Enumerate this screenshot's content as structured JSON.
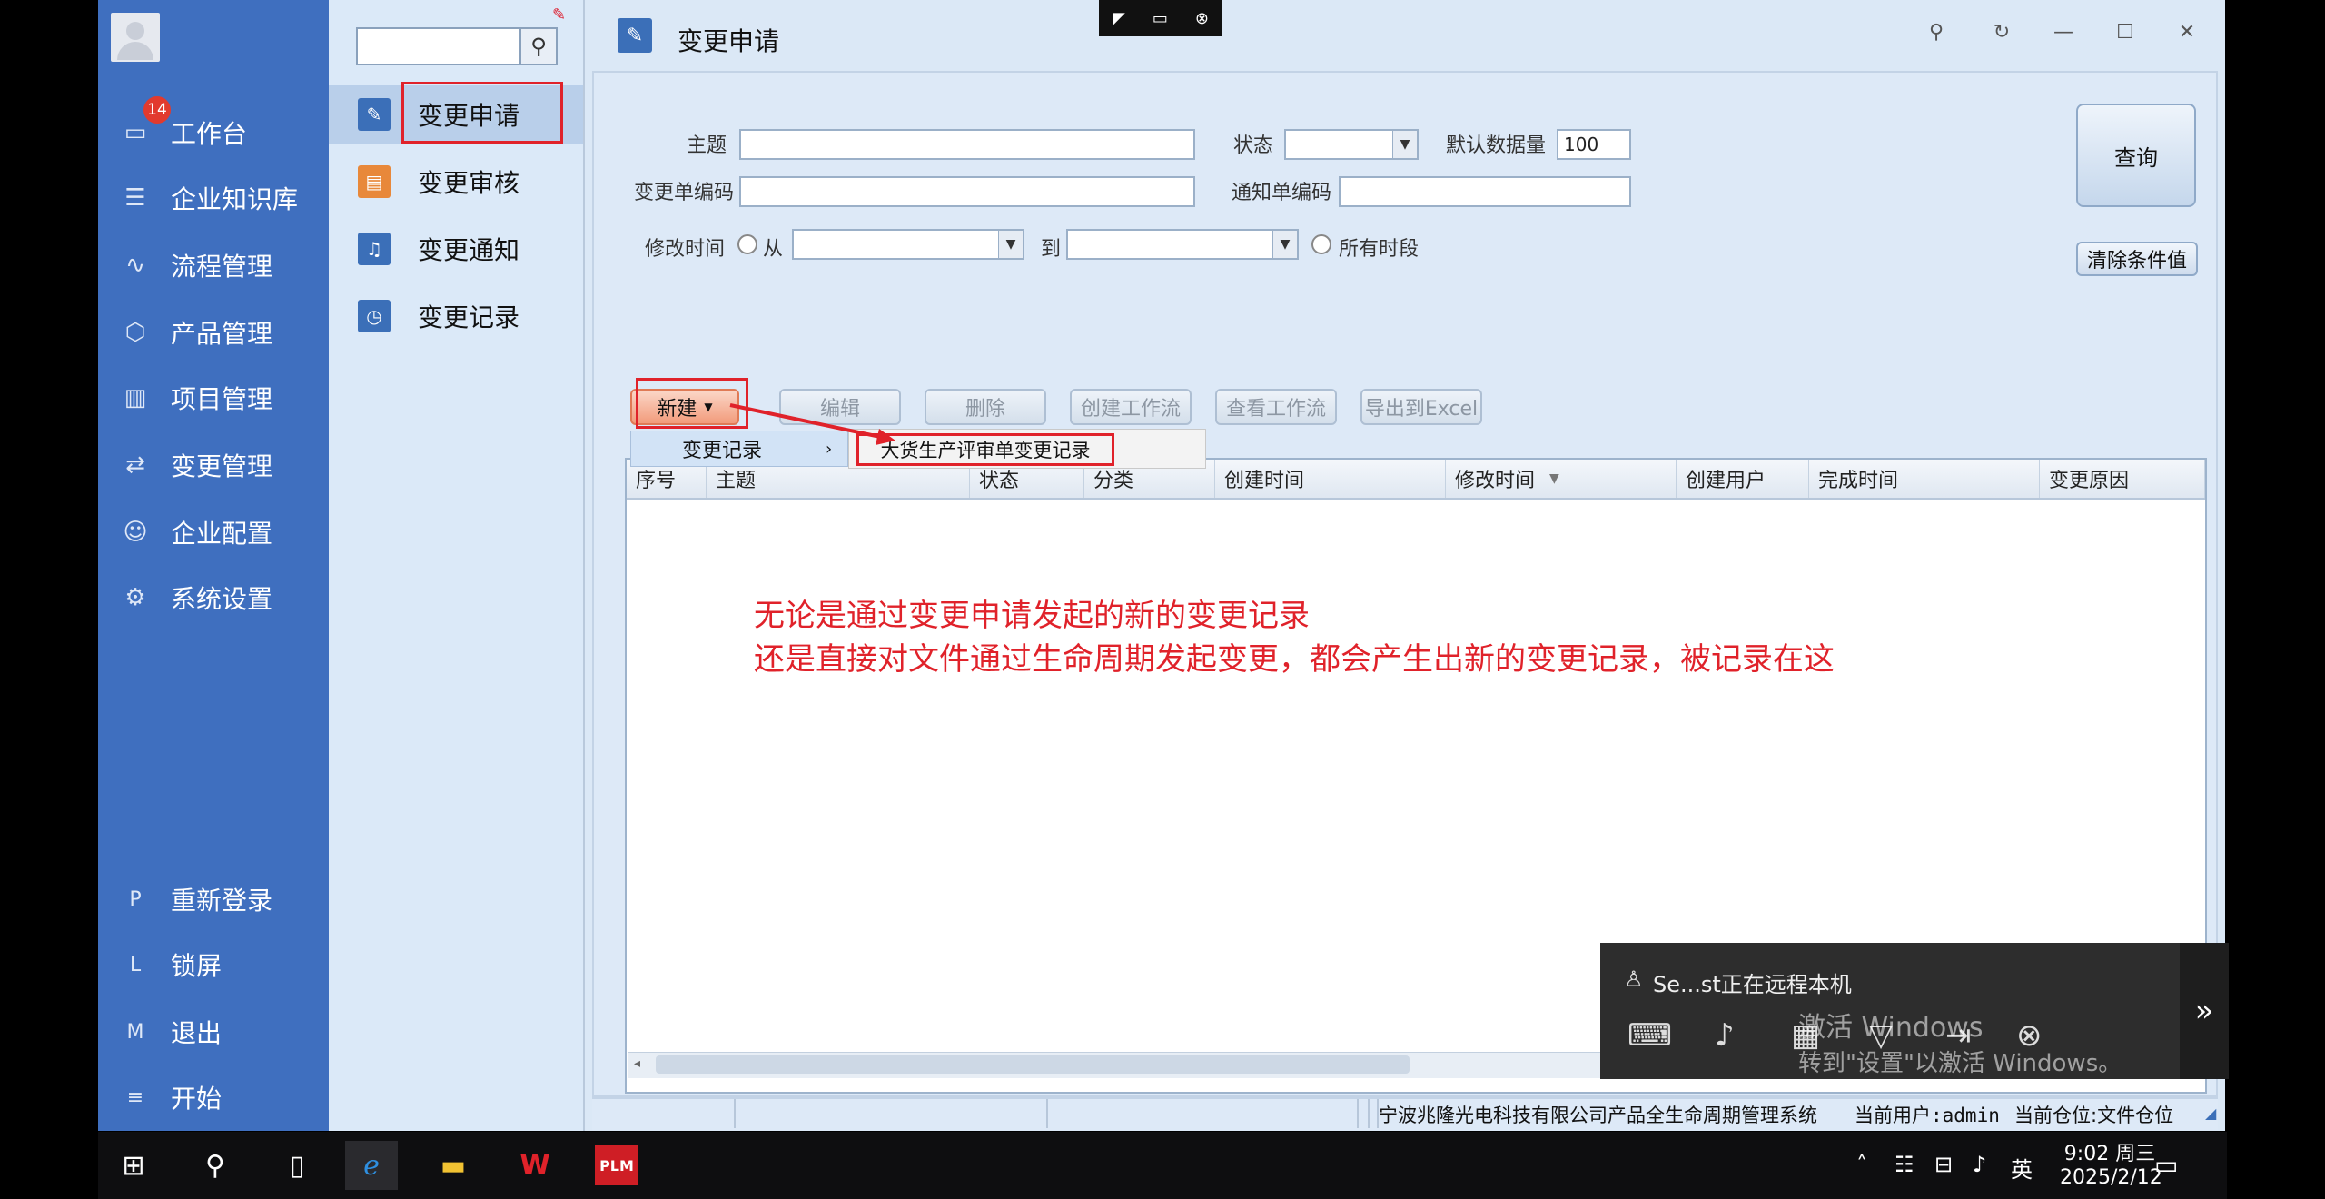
{
  "nav": {
    "badge": "14",
    "items": [
      {
        "label": "工作台",
        "icon": "monitor-icon"
      },
      {
        "label": "企业知识库",
        "icon": "book-icon"
      },
      {
        "label": "流程管理",
        "icon": "flow-icon"
      },
      {
        "label": "产品管理",
        "icon": "cube-icon"
      },
      {
        "label": "项目管理",
        "icon": "chart-icon"
      },
      {
        "label": "变更管理",
        "icon": "change-icon"
      },
      {
        "label": "企业配置",
        "icon": "users-icon"
      },
      {
        "label": "系统设置",
        "icon": "gear-icon"
      }
    ],
    "bottom": [
      {
        "key": "P",
        "label": "重新登录"
      },
      {
        "key": "L",
        "label": "锁屏"
      },
      {
        "key": "M",
        "label": "退出"
      },
      {
        "key": "≡",
        "label": "开始"
      }
    ]
  },
  "subnav": {
    "items": [
      "变更申请",
      "变更审核",
      "变更通知",
      "变更记录"
    ]
  },
  "window": {
    "title": "变更申请"
  },
  "form": {
    "subject_label": "主题",
    "status_label": "状态",
    "default_count_label": "默认数据量",
    "default_count_value": "100",
    "change_code_label": "变更单编码",
    "notice_code_label": "通知单编码",
    "modify_time_label": "修改时间",
    "from_label": "从",
    "to_label": "到",
    "all_periods_label": "所有时段",
    "query_button": "查询",
    "clear_button": "清除条件值"
  },
  "toolbar": {
    "new": "新建",
    "edit": "编辑",
    "delete": "删除",
    "create_workflow": "创建工作流",
    "view_workflow": "查看工作流",
    "export_excel": "导出到Excel"
  },
  "menu": {
    "item": "变更记录",
    "subitem": "大货生产评审单变更记录"
  },
  "grid": {
    "columns": [
      "序号",
      "主题",
      "状态",
      "分类",
      "创建时间",
      "修改时间",
      "创建用户",
      "完成时间",
      "变更原因"
    ]
  },
  "annotation": {
    "line1": "无论是通过变更申请发起的新的变更记录",
    "line2": "还是直接对文件通过生命周期发起变更，都会产生出新的变更记录，被记录在这"
  },
  "status": {
    "company": "宁波兆隆光电科技有限公司产品全生命周期管理系统",
    "user_label": "当前用户:admin",
    "location_label": "当前仓位:文件仓位"
  },
  "remote_popup": {
    "text": "Se...st正在远程本机",
    "watermark1": "激活 Windows",
    "watermark2": "转到\"设置\"以激活 Windows。"
  },
  "taskbar": {
    "app_label": "PLM",
    "ime": "英",
    "time": "9:02 周三",
    "date": "2025/2/12"
  }
}
